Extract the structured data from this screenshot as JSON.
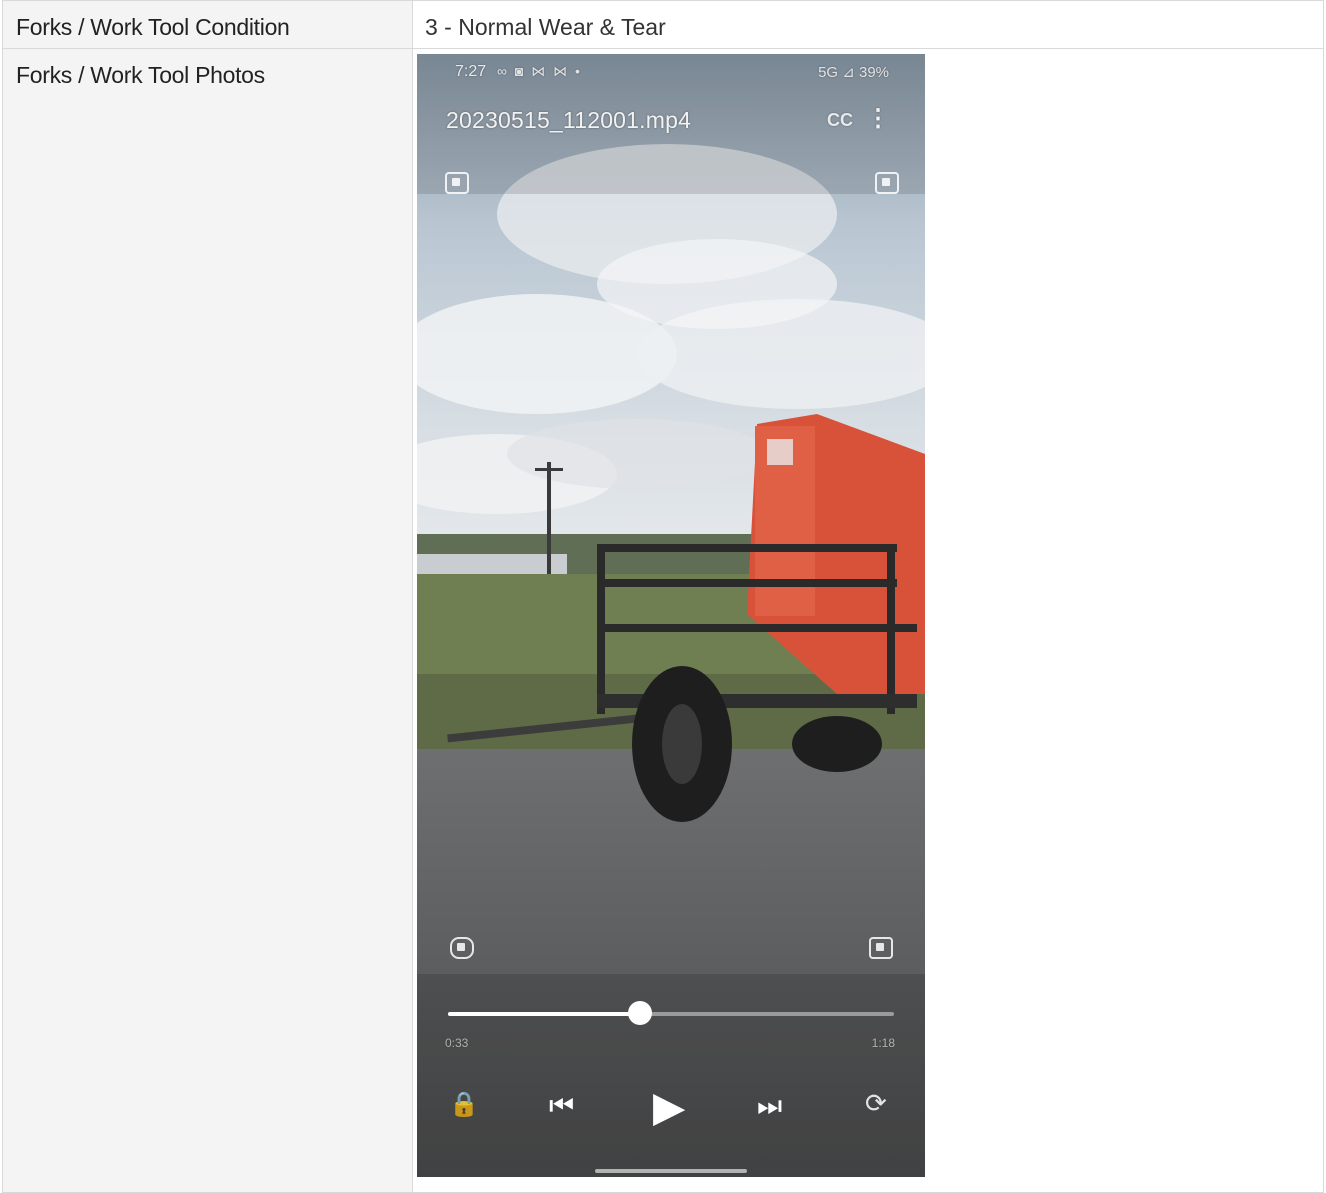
{
  "rows": [
    {
      "label": "Forks / Work Tool Condition",
      "value": "3 - Normal Wear & Tear"
    },
    {
      "label": "Forks / Work Tool Photos"
    }
  ],
  "video": {
    "status_time": "7:27",
    "status_icons": "∞ ◙ ⋈ ⋈ •",
    "status_right": "5G ⊿ 39%",
    "filename": "20230515_112001.mp4",
    "cc_label": "CC",
    "more_glyph": "⋮",
    "elapsed": "0:33",
    "total": "1:18",
    "progress_fraction": 0.43,
    "icons": {
      "lock": "🔒",
      "prev": "⏮",
      "play": "▶",
      "next": "⏭",
      "rotate": "⟳"
    }
  }
}
